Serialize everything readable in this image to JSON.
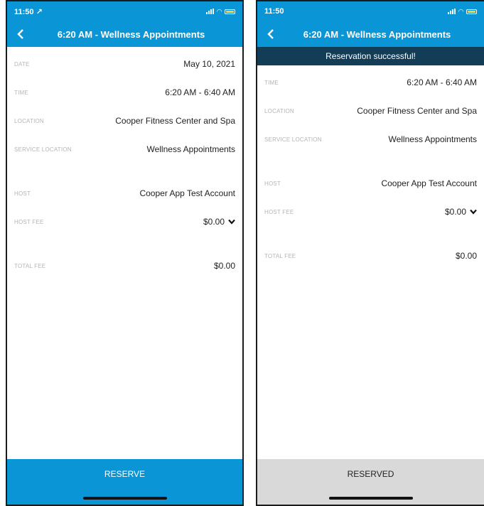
{
  "colors": {
    "brand": "#0a96d6",
    "toast": "#133d57",
    "reserved": "#d9d9d9"
  },
  "left": {
    "status": {
      "time": "11:50",
      "location_arrow": "↗"
    },
    "header": {
      "title": "6:20 AM - Wellness Appointments"
    },
    "rows": [
      {
        "label": "DATE",
        "value": "May 10, 2021"
      },
      {
        "label": "TIME",
        "value": "6:20 AM - 6:40 AM"
      },
      {
        "label": "LOCATION",
        "value": "Cooper Fitness Center and Spa"
      },
      {
        "label": "SERVICE LOCATION",
        "value": "Wellness Appointments"
      },
      {
        "label": "HOST",
        "value": "Cooper App Test Account"
      },
      {
        "label": "HOST FEE",
        "value": "$0.00"
      },
      {
        "label": "TOTAL FEE",
        "value": "$0.00"
      }
    ],
    "button": {
      "label": "RESERVE"
    }
  },
  "right": {
    "status": {
      "time": "11:50"
    },
    "header": {
      "title": "6:20 AM - Wellness Appointments"
    },
    "toast": "Reservation successful!",
    "rows": [
      {
        "label": "TIME",
        "value": "6:20 AM - 6:40 AM"
      },
      {
        "label": "LOCATION",
        "value": "Cooper Fitness Center and Spa"
      },
      {
        "label": "SERVICE LOCATION",
        "value": "Wellness Appointments"
      },
      {
        "label": "HOST",
        "value": "Cooper App Test Account"
      },
      {
        "label": "HOST FEE",
        "value": "$0.00"
      },
      {
        "label": "TOTAL FEE",
        "value": "$0.00"
      }
    ],
    "button": {
      "label": "RESERVED"
    }
  },
  "icons": [
    "back-icon",
    "chevron-down-icon",
    "signal-icon",
    "wifi-icon",
    "battery-icon"
  ]
}
